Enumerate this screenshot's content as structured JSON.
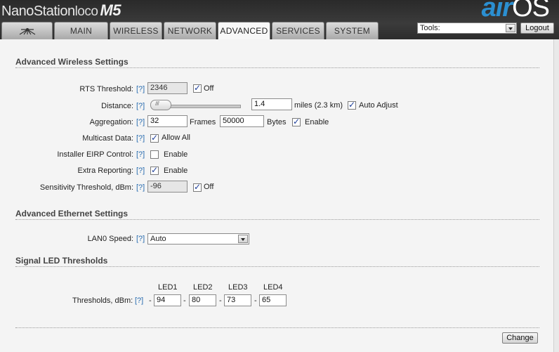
{
  "header": {
    "brand_name": "NanoStation",
    "brand_model": "loco",
    "brand_suffix": "M5",
    "os_logo_air": "air",
    "os_logo_os": "OS"
  },
  "tabs": [
    {
      "label": "",
      "icon": "ubiquiti-logo-icon"
    },
    {
      "label": "MAIN"
    },
    {
      "label": "WIRELESS"
    },
    {
      "label": "NETWORK"
    },
    {
      "label": "ADVANCED",
      "active": true
    },
    {
      "label": "SERVICES"
    },
    {
      "label": "SYSTEM"
    }
  ],
  "tools": {
    "label": "Tools:"
  },
  "logout_label": "Logout",
  "help_label": "[?]",
  "wireless": {
    "title": "Advanced Wireless Settings",
    "rts": {
      "label": "RTS Threshold:",
      "value": "2346",
      "checkbox_checked": true,
      "checkbox_label": "Off"
    },
    "distance": {
      "label": "Distance:",
      "value": "1.4",
      "units": "miles (2.3 km)",
      "auto_checked": true,
      "auto_label": "Auto Adjust"
    },
    "aggregation": {
      "label": "Aggregation:",
      "frames_value": "32",
      "frames_label": "Frames",
      "bytes_value": "50000",
      "bytes_label": "Bytes",
      "enable_checked": true,
      "enable_label": "Enable"
    },
    "multicast": {
      "label": "Multicast Data:",
      "checked": true,
      "option_label": "Allow All"
    },
    "eirp": {
      "label": "Installer EIRP Control:",
      "checked": false,
      "option_label": "Enable"
    },
    "extra": {
      "label": "Extra Reporting:",
      "checked": true,
      "option_label": "Enable"
    },
    "sensitivity": {
      "label": "Sensitivity Threshold, dBm:",
      "value": "-96",
      "checkbox_checked": true,
      "checkbox_label": "Off"
    }
  },
  "ethernet": {
    "title": "Advanced Ethernet Settings",
    "lan0": {
      "label": "LAN0 Speed:",
      "selected": "Auto"
    }
  },
  "led": {
    "title": "Signal LED Thresholds",
    "thresholds_label": "Thresholds, dBm:",
    "dash": "-",
    "columns": [
      "LED1",
      "LED2",
      "LED3",
      "LED4"
    ],
    "values": [
      "94",
      "80",
      "73",
      "65"
    ]
  },
  "change_label": "Change",
  "colors": {
    "accent_blue": "#2b8fd1",
    "help_link": "#2a6db0",
    "header_dark": "#2f2f2f"
  }
}
